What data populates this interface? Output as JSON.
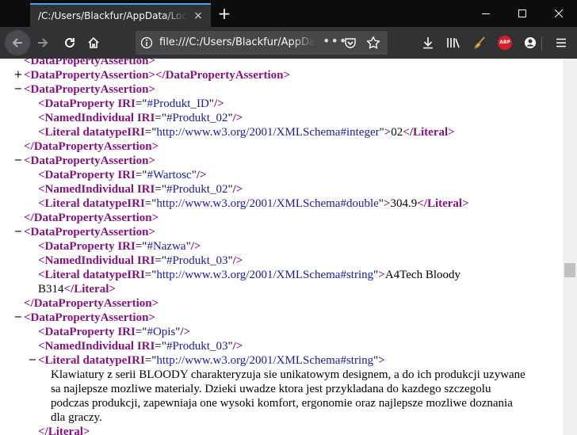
{
  "window": {
    "tab_title": "/C:/Users/Blackfur/AppData/Local/",
    "tab_close_glyph": "×",
    "new_tab_glyph": "+"
  },
  "navbar": {
    "url": "file:///C:/Users/Blackfur/AppData/Local/",
    "more_glyph": "•••"
  },
  "xml": {
    "collapse_glyph": "−",
    "expand_glyph": "+",
    "lines": [
      {
        "indent": 30,
        "ctl": "",
        "parts": [
          [
            "el",
            "<DataPropertyAssertion>"
          ]
        ]
      },
      {
        "indent": 30,
        "ctl": "+",
        "parts": [
          [
            "el",
            "<DataPropertyAssertion>"
          ],
          [
            "el",
            "</DataPropertyAssertion>"
          ]
        ]
      },
      {
        "indent": 30,
        "ctl": "−",
        "parts": [
          [
            "el",
            "<DataPropertyAssertion>"
          ]
        ]
      },
      {
        "indent": 48,
        "ctl": "",
        "parts": [
          [
            "el",
            "<DataProperty "
          ],
          [
            "an",
            "IRI"
          ],
          [
            "tx",
            "=\""
          ],
          [
            "av",
            "#Produkt_ID"
          ],
          [
            "tx",
            "\""
          ],
          [
            "el",
            "/>"
          ]
        ]
      },
      {
        "indent": 48,
        "ctl": "",
        "parts": [
          [
            "el",
            "<NamedIndividual "
          ],
          [
            "an",
            "IRI"
          ],
          [
            "tx",
            "=\""
          ],
          [
            "av",
            "#Produkt_02"
          ],
          [
            "tx",
            "\""
          ],
          [
            "el",
            "/>"
          ]
        ]
      },
      {
        "indent": 48,
        "ctl": "",
        "parts": [
          [
            "el",
            "<Literal "
          ],
          [
            "an",
            "datatypeIRI"
          ],
          [
            "tx",
            "=\""
          ],
          [
            "av",
            "http://www.w3.org/2001/XMLSchema#integer"
          ],
          [
            "tx",
            "\""
          ],
          [
            "el",
            ">"
          ],
          [
            "tx",
            "02"
          ],
          [
            "el",
            "</Literal>"
          ]
        ]
      },
      {
        "indent": 30,
        "ctl": "",
        "parts": [
          [
            "el",
            "</DataPropertyAssertion>"
          ]
        ]
      },
      {
        "indent": 30,
        "ctl": "−",
        "parts": [
          [
            "el",
            "<DataPropertyAssertion>"
          ]
        ]
      },
      {
        "indent": 48,
        "ctl": "",
        "parts": [
          [
            "el",
            "<DataProperty "
          ],
          [
            "an",
            "IRI"
          ],
          [
            "tx",
            "=\""
          ],
          [
            "av",
            "#Wartosc"
          ],
          [
            "tx",
            "\""
          ],
          [
            "el",
            "/>"
          ]
        ]
      },
      {
        "indent": 48,
        "ctl": "",
        "parts": [
          [
            "el",
            "<NamedIndividual "
          ],
          [
            "an",
            "IRI"
          ],
          [
            "tx",
            "=\""
          ],
          [
            "av",
            "#Produkt_02"
          ],
          [
            "tx",
            "\""
          ],
          [
            "el",
            "/>"
          ]
        ]
      },
      {
        "indent": 48,
        "ctl": "",
        "parts": [
          [
            "el",
            "<Literal "
          ],
          [
            "an",
            "datatypeIRI"
          ],
          [
            "tx",
            "=\""
          ],
          [
            "av",
            "http://www.w3.org/2001/XMLSchema#double"
          ],
          [
            "tx",
            "\""
          ],
          [
            "el",
            ">"
          ],
          [
            "tx",
            "304.9"
          ],
          [
            "el",
            "</Literal>"
          ]
        ]
      },
      {
        "indent": 30,
        "ctl": "",
        "parts": [
          [
            "el",
            "</DataPropertyAssertion>"
          ]
        ]
      },
      {
        "indent": 30,
        "ctl": "−",
        "parts": [
          [
            "el",
            "<DataPropertyAssertion>"
          ]
        ]
      },
      {
        "indent": 48,
        "ctl": "",
        "parts": [
          [
            "el",
            "<DataProperty "
          ],
          [
            "an",
            "IRI"
          ],
          [
            "tx",
            "=\""
          ],
          [
            "av",
            "#Nazwa"
          ],
          [
            "tx",
            "\""
          ],
          [
            "el",
            "/>"
          ]
        ]
      },
      {
        "indent": 48,
        "ctl": "",
        "parts": [
          [
            "el",
            "<NamedIndividual "
          ],
          [
            "an",
            "IRI"
          ],
          [
            "tx",
            "=\""
          ],
          [
            "av",
            "#Produkt_03"
          ],
          [
            "tx",
            "\""
          ],
          [
            "el",
            "/>"
          ]
        ]
      },
      {
        "indent": 48,
        "ctl": "",
        "parts": [
          [
            "el",
            "<Literal "
          ],
          [
            "an",
            "datatypeIRI"
          ],
          [
            "tx",
            "=\""
          ],
          [
            "av",
            "http://www.w3.org/2001/XMLSchema#string"
          ],
          [
            "tx",
            "\""
          ],
          [
            "el",
            ">"
          ],
          [
            "tx",
            "A4Tech Bloody"
          ]
        ]
      },
      {
        "indent": 48,
        "ctl": "",
        "parts": [
          [
            "tx",
            "B314"
          ],
          [
            "el",
            "</Literal>"
          ]
        ]
      },
      {
        "indent": 30,
        "ctl": "",
        "parts": [
          [
            "el",
            "</DataPropertyAssertion>"
          ]
        ]
      },
      {
        "indent": 30,
        "ctl": "−",
        "parts": [
          [
            "el",
            "<DataPropertyAssertion>"
          ]
        ]
      },
      {
        "indent": 48,
        "ctl": "",
        "parts": [
          [
            "el",
            "<DataProperty "
          ],
          [
            "an",
            "IRI"
          ],
          [
            "tx",
            "=\""
          ],
          [
            "av",
            "#Opis"
          ],
          [
            "tx",
            "\""
          ],
          [
            "el",
            "/>"
          ]
        ]
      },
      {
        "indent": 48,
        "ctl": "",
        "parts": [
          [
            "el",
            "<NamedIndividual "
          ],
          [
            "an",
            "IRI"
          ],
          [
            "tx",
            "=\""
          ],
          [
            "av",
            "#Produkt_03"
          ],
          [
            "tx",
            "\""
          ],
          [
            "el",
            "/>"
          ]
        ]
      },
      {
        "indent": 48,
        "ctl": "−",
        "parts": [
          [
            "el",
            "<Literal "
          ],
          [
            "an",
            "datatypeIRI"
          ],
          [
            "tx",
            "=\""
          ],
          [
            "av",
            "http://www.w3.org/2001/XMLSchema#string"
          ],
          [
            "tx",
            "\""
          ],
          [
            "el",
            ">"
          ]
        ]
      },
      {
        "indent": 64,
        "ctl": "",
        "parts": [
          [
            "tx",
            "Klawiatury z serii BLOODY charakteryzuja sie unikatowym designem, a do ich produkcji uzywane"
          ]
        ]
      },
      {
        "indent": 64,
        "ctl": "",
        "parts": [
          [
            "tx",
            "sa najlepsze mozliwe materialy. Dzieki uwadze ktora jest przykladana do kazdego szczegolu"
          ]
        ]
      },
      {
        "indent": 64,
        "ctl": "",
        "parts": [
          [
            "tx",
            "podczas produkcji, zapewniaja one wysoki komfort, ergonomie oraz najlepsze mozliwe doznania"
          ]
        ]
      },
      {
        "indent": 64,
        "ctl": "",
        "parts": [
          [
            "tx",
            "dla graczy."
          ]
        ]
      },
      {
        "indent": 48,
        "ctl": "",
        "parts": [
          [
            "el",
            "</Literal>"
          ]
        ]
      }
    ]
  },
  "colors": {
    "element": "#881280",
    "attr_value": "#1a1aa6",
    "accent": "#45a1ff"
  }
}
